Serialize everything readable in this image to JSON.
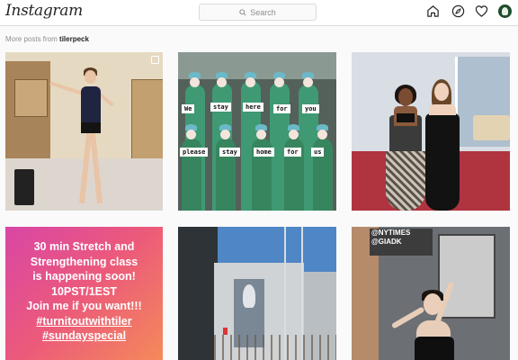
{
  "header": {
    "logo": "Instagram",
    "search_placeholder": "Search",
    "icons": [
      "home-icon",
      "explore-compass-icon",
      "heart-icon",
      "profile-avatar"
    ]
  },
  "section": {
    "label_prefix": "More posts from",
    "username": "tilerpeck"
  },
  "tiles": {
    "medical_signs": [
      "We",
      "stay",
      "here",
      "for",
      "you",
      "please",
      "stay",
      "home",
      "for",
      "us"
    ],
    "promo_lines": [
      "30 min Stretch and",
      "Strengthening class",
      "is happening soon!",
      "10PST/1EST",
      "Join me if you want!!!",
      "#turnitoutwithtiler",
      "#sundayspecial"
    ],
    "poster_text_1": "@NYTIMES",
    "poster_text_2": "@GIADK"
  },
  "colors": {
    "promo_gradient_start": "#d946a6",
    "promo_gradient_end": "#f48a5a",
    "header_border": "#dbdbdb"
  }
}
